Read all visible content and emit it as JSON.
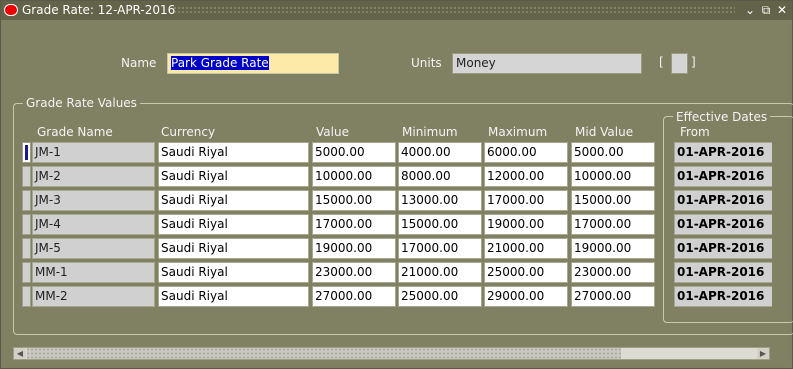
{
  "window": {
    "title": "Grade Rate: 12-APR-2016",
    "controls": {
      "minimize": "⌄",
      "maximize": "⧉",
      "close": "✕"
    }
  },
  "form": {
    "name_label": "Name",
    "name_value": "Park Grade Rate",
    "units_label": "Units",
    "units_value": "Money",
    "bracket_open": "[",
    "bracket_close": "]"
  },
  "rates": {
    "group_title": "Grade Rate Values",
    "headers": {
      "grade_name": "Grade Name",
      "currency": "Currency",
      "value": "Value",
      "minimum": "Minimum",
      "maximum": "Maximum",
      "mid_value": "Mid Value"
    },
    "rows": [
      {
        "grade": "JM-1",
        "currency": "Saudi Riyal",
        "value": "5000.00",
        "min": "4000.00",
        "max": "6000.00",
        "mid": "5000.00",
        "from": "01-APR-2016"
      },
      {
        "grade": "JM-2",
        "currency": "Saudi Riyal",
        "value": "10000.00",
        "min": "8000.00",
        "max": "12000.00",
        "mid": "10000.00",
        "from": "01-APR-2016"
      },
      {
        "grade": "JM-3",
        "currency": "Saudi Riyal",
        "value": "15000.00",
        "min": "13000.00",
        "max": "17000.00",
        "mid": "15000.00",
        "from": "01-APR-2016"
      },
      {
        "grade": "JM-4",
        "currency": "Saudi Riyal",
        "value": "17000.00",
        "min": "15000.00",
        "max": "19000.00",
        "mid": "17000.00",
        "from": "01-APR-2016"
      },
      {
        "grade": "JM-5",
        "currency": "Saudi Riyal",
        "value": "19000.00",
        "min": "17000.00",
        "max": "21000.00",
        "mid": "19000.00",
        "from": "01-APR-2016"
      },
      {
        "grade": "MM-1",
        "currency": "Saudi Riyal",
        "value": "23000.00",
        "min": "21000.00",
        "max": "25000.00",
        "mid": "23000.00",
        "from": "01-APR-2016"
      },
      {
        "grade": "MM-2",
        "currency": "Saudi Riyal",
        "value": "27000.00",
        "min": "25000.00",
        "max": "29000.00",
        "mid": "27000.00",
        "from": "01-APR-2016"
      }
    ]
  },
  "effective_dates": {
    "group_title": "Effective Dates",
    "from_label": "From"
  },
  "scrollbar": {
    "left_arrow": "◀",
    "right_arrow": "▶"
  }
}
